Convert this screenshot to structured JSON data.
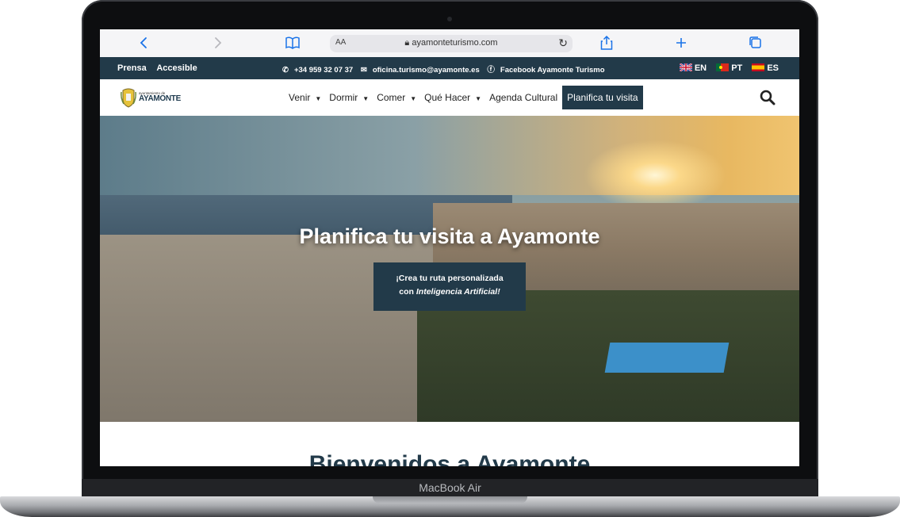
{
  "browser": {
    "aa_label": "AA",
    "url": "ayamonteturismo.com"
  },
  "infobar": {
    "links": [
      "Prensa",
      "Accesible"
    ],
    "phone": "+34 959 32 07 37",
    "email": "oficina.turismo@ayamonte.es",
    "facebook": "Facebook Ayamonte Turismo",
    "languages": [
      "EN",
      "PT",
      "ES"
    ]
  },
  "logo": {
    "small": "ayuntamiento de",
    "big": "AYAMONTE"
  },
  "nav": {
    "items": [
      "Venir",
      "Dormir",
      "Comer",
      "Qué Hacer",
      "Agenda Cultural"
    ],
    "cta": "Planifica tu visita"
  },
  "hero": {
    "title": "Planifica tu visita a Ayamonte",
    "button_line1": "¡Crea tu ruta personalizada",
    "button_line2_prefix": "con ",
    "button_line2_em": "Inteligencia Artificial!"
  },
  "welcome": "Bienvenidos a Ayamonte",
  "device": {
    "model": "MacBook Air"
  },
  "colors": {
    "brand": "#223a49",
    "toolbar": "#f5f5f7",
    "accent_blue": "#1a73e8"
  }
}
